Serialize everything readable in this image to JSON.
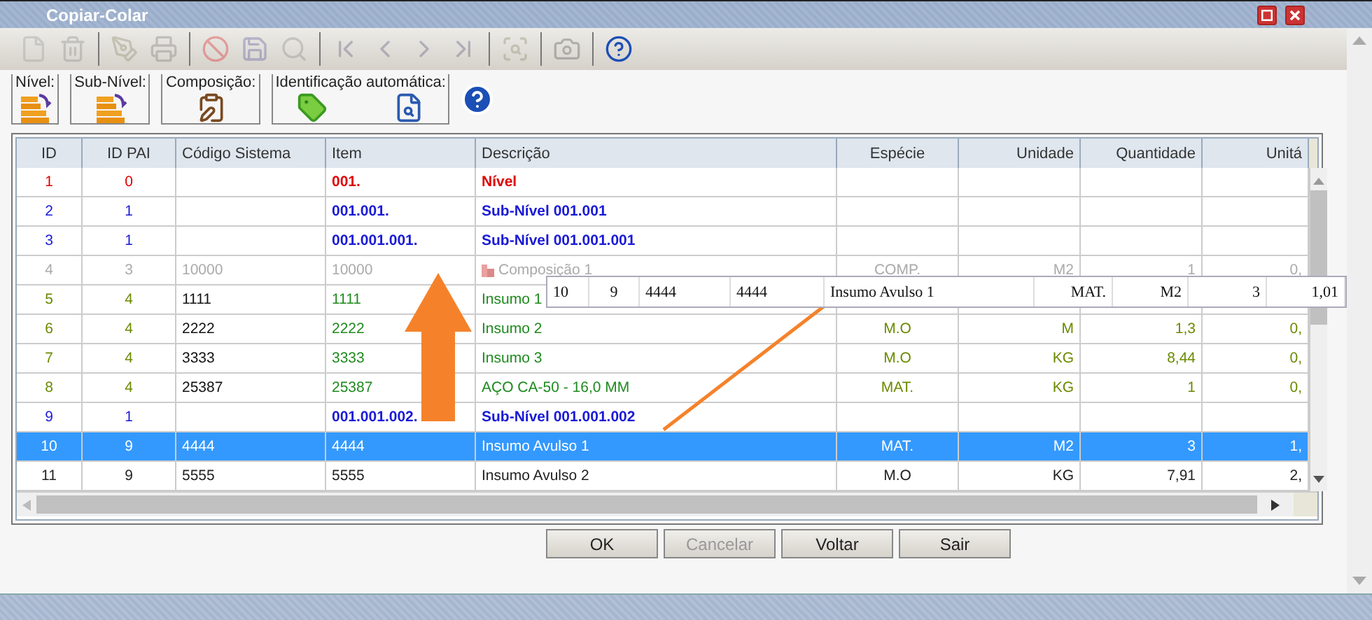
{
  "window": {
    "title": "Copiar-Colar"
  },
  "toolbar": {
    "groups": [
      [
        {
          "disabled": true
        },
        {
          "disabled": true
        }
      ],
      [
        {
          "disabled": true
        },
        {
          "disabled": true
        }
      ],
      [
        {
          "disabled": true
        },
        {
          "disabled": true
        },
        {
          "disabled": true
        }
      ],
      [
        {
          "disabled": true
        },
        {
          "disabled": true
        },
        {
          "disabled": true
        },
        {
          "disabled": true
        }
      ],
      [
        {
          "disabled": true
        }
      ],
      [
        {
          "disabled": true
        }
      ],
      [
        {
          "disabled": false
        }
      ]
    ]
  },
  "groups": [
    {
      "label": "Nível:"
    },
    {
      "label": "Sub-Nível:"
    },
    {
      "label": "Composição:"
    },
    {
      "label": "Identificação automática:"
    }
  ],
  "table": {
    "columns": [
      "ID",
      "ID PAI",
      "Código Sistema",
      "Item",
      "Descrição",
      "Espécie",
      "Unidade",
      "Quantidade",
      "Unitá"
    ],
    "rows": [
      {
        "kind": "nivel",
        "selected": false,
        "cells": [
          "1",
          "0",
          "",
          "001.",
          "Nível",
          "",
          "",
          "",
          ""
        ]
      },
      {
        "kind": "subnivel",
        "selected": false,
        "cells": [
          "2",
          "1",
          "",
          "001.001.",
          "Sub-Nível 001.001",
          "",
          "",
          "",
          ""
        ]
      },
      {
        "kind": "subnivel",
        "selected": false,
        "cells": [
          "3",
          "1",
          "",
          "001.001.001.",
          "Sub-Nível 001.001.001",
          "",
          "",
          "",
          ""
        ]
      },
      {
        "kind": "composicao",
        "selected": false,
        "cells": [
          "4",
          "3",
          "10000",
          "10000",
          "Composição 1",
          "COMP.",
          "M2",
          "1",
          "0,"
        ]
      },
      {
        "kind": "insumo",
        "selected": false,
        "cells": [
          "5",
          "4",
          "1111",
          "1111",
          "Insumo 1",
          "",
          "",
          "",
          ""
        ]
      },
      {
        "kind": "insumo",
        "selected": false,
        "cells": [
          "6",
          "4",
          "2222",
          "2222",
          "Insumo 2",
          "M.O",
          "M",
          "1,3",
          "0,"
        ]
      },
      {
        "kind": "insumo",
        "selected": false,
        "cells": [
          "7",
          "4",
          "3333",
          "3333",
          "Insumo 3",
          "M.O",
          "KG",
          "8,44",
          "0,"
        ]
      },
      {
        "kind": "insumo",
        "selected": false,
        "cells": [
          "8",
          "4",
          "25387",
          "25387",
          "AÇO CA-50 - 16,0 MM",
          "MAT.",
          "KG",
          "1",
          "0,"
        ]
      },
      {
        "kind": "subnivel",
        "selected": false,
        "cells": [
          "9",
          "1",
          "",
          "001.001.002.",
          "Sub-Nível 001.001.002",
          "",
          "",
          "",
          ""
        ]
      },
      {
        "kind": "avulso",
        "selected": true,
        "cells": [
          "10",
          "9",
          "4444",
          "4444",
          "Insumo Avulso 1",
          "MAT.",
          "M2",
          "3",
          "1,"
        ]
      },
      {
        "kind": "avulso",
        "selected": false,
        "cells": [
          "11",
          "9",
          "5555",
          "5555",
          "Insumo Avulso 2",
          "M.O",
          "KG",
          "7,91",
          "2,"
        ]
      }
    ]
  },
  "drag_preview": {
    "cells": [
      "10",
      "9",
      "4444",
      "4444",
      "Insumo Avulso 1",
      "MAT.",
      "M2",
      "3",
      "1,01"
    ]
  },
  "buttons": [
    {
      "label": "OK",
      "disabled": false
    },
    {
      "label": "Cancelar",
      "disabled": true
    },
    {
      "label": "Voltar",
      "disabled": false
    },
    {
      "label": "Sair",
      "disabled": false
    }
  ]
}
